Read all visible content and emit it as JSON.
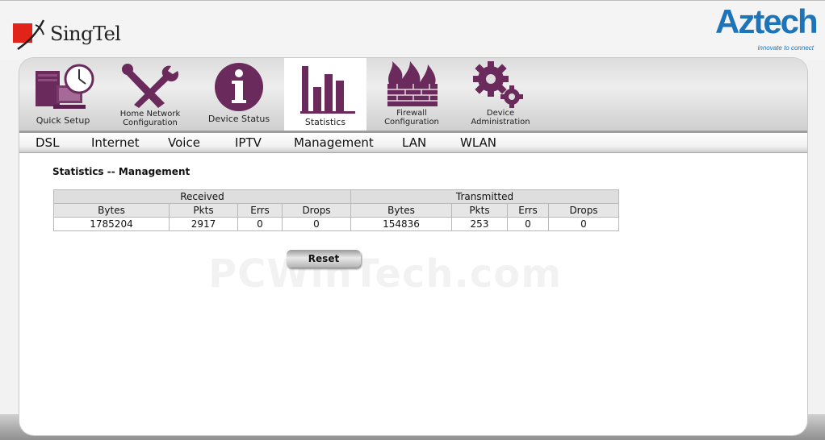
{
  "header": {
    "singtel_logo": "SingTel",
    "aztech_logo": "Aztech",
    "aztech_tagline": "innovate to connect"
  },
  "nav": [
    {
      "label": "Quick Setup",
      "icon": "computer-clock-icon"
    },
    {
      "label": "Home Network\nConfiguration",
      "icon": "tools-icon"
    },
    {
      "label": "Device Status",
      "icon": "info-icon"
    },
    {
      "label": "Statistics",
      "icon": "bar-chart-icon",
      "active": true
    },
    {
      "label": "Firewall\nConfiguration",
      "icon": "firewall-icon"
    },
    {
      "label": "Device\nAdministration",
      "icon": "gears-icon"
    }
  ],
  "menu": [
    "DSL",
    "Internet",
    "Voice",
    "IPTV",
    "Management",
    "LAN",
    "WLAN"
  ],
  "page_title": "Statistics -- Management",
  "table": {
    "group_received": "Received",
    "group_transmitted": "Transmitted",
    "columns": [
      "Bytes",
      "Pkts",
      "Errs",
      "Drops",
      "Bytes",
      "Pkts",
      "Errs",
      "Drops"
    ],
    "row": [
      "1785204",
      "2917",
      "0",
      "0",
      "154836",
      "253",
      "0",
      "0"
    ]
  },
  "reset_label": "Reset",
  "watermark": "PCWinTech.com",
  "colors": {
    "accent_purple": "#6b2a5c",
    "aztech_blue": "#1d74b8",
    "singtel_red": "#e2231a"
  }
}
